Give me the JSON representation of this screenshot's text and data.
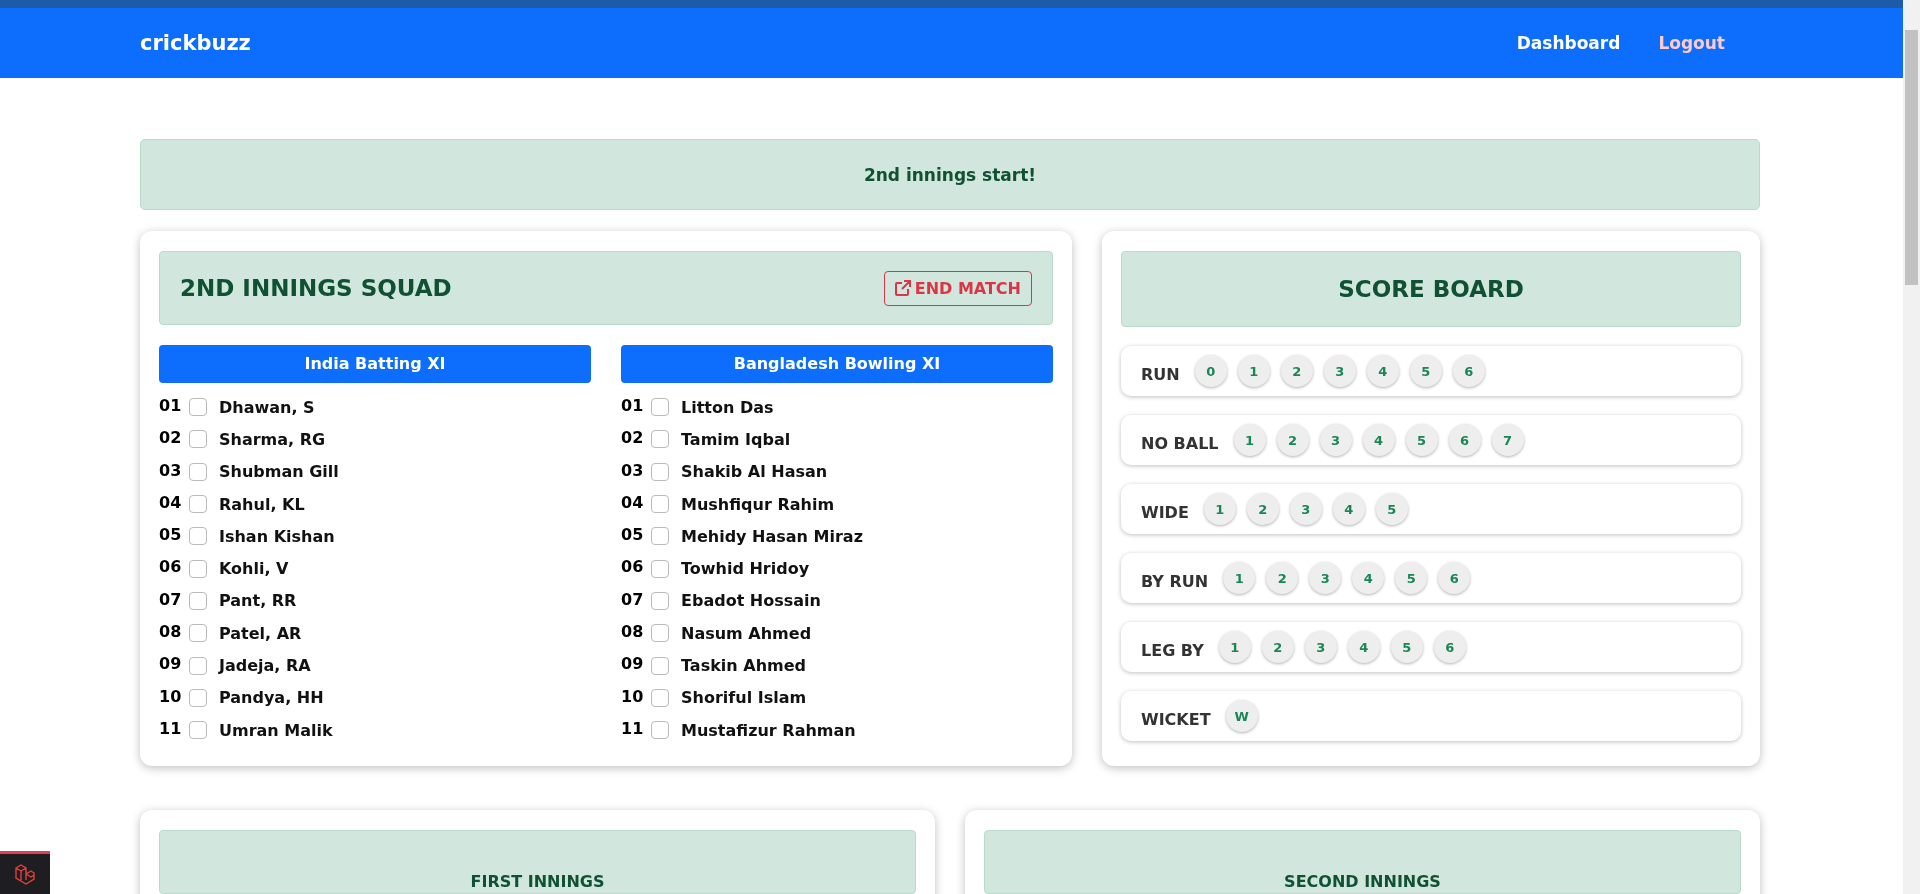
{
  "navbar": {
    "brand": "crickbuzz",
    "links": [
      {
        "label": "Dashboard",
        "kind": "normal"
      },
      {
        "label": "Logout",
        "kind": "danger"
      }
    ]
  },
  "alert": "2nd innings start!",
  "squad": {
    "title": "2ND INNINGS SQUAD",
    "end_button": "END MATCH",
    "teams": [
      {
        "title": "India Batting XI",
        "players": [
          {
            "no": "01",
            "name": "Dhawan, S",
            "checked": false
          },
          {
            "no": "02",
            "name": "Sharma, RG",
            "checked": false
          },
          {
            "no": "03",
            "name": "Shubman Gill",
            "checked": false
          },
          {
            "no": "04",
            "name": "Rahul, KL",
            "checked": false
          },
          {
            "no": "05",
            "name": "Ishan Kishan",
            "checked": false
          },
          {
            "no": "06",
            "name": "Kohli, V",
            "checked": false
          },
          {
            "no": "07",
            "name": "Pant, RR",
            "checked": false
          },
          {
            "no": "08",
            "name": "Patel, AR",
            "checked": false
          },
          {
            "no": "09",
            "name": "Jadeja, RA",
            "checked": false
          },
          {
            "no": "10",
            "name": "Pandya, HH",
            "checked": false
          },
          {
            "no": "11",
            "name": "Umran Malik",
            "checked": false
          }
        ]
      },
      {
        "title": "Bangladesh Bowling XI",
        "players": [
          {
            "no": "01",
            "name": "Litton Das",
            "checked": false
          },
          {
            "no": "02",
            "name": "Tamim Iqbal",
            "checked": false
          },
          {
            "no": "03",
            "name": "Shakib Al Hasan",
            "checked": false
          },
          {
            "no": "04",
            "name": "Mushfiqur Rahim",
            "checked": false
          },
          {
            "no": "05",
            "name": "Mehidy Hasan Miraz",
            "checked": false
          },
          {
            "no": "06",
            "name": "Towhid Hridoy",
            "checked": false
          },
          {
            "no": "07",
            "name": "Ebadot Hossain",
            "checked": false
          },
          {
            "no": "08",
            "name": "Nasum Ahmed",
            "checked": false
          },
          {
            "no": "09",
            "name": "Taskin Ahmed",
            "checked": false
          },
          {
            "no": "10",
            "name": "Shoriful Islam",
            "checked": false
          },
          {
            "no": "11",
            "name": "Mustafizur Rahman",
            "checked": false
          }
        ]
      }
    ]
  },
  "scoreboard": {
    "title": "SCORE BOARD",
    "rows": [
      {
        "label": "RUN",
        "buttons": [
          "0",
          "1",
          "2",
          "3",
          "4",
          "5",
          "6"
        ]
      },
      {
        "label": "NO BALL",
        "buttons": [
          "1",
          "2",
          "3",
          "4",
          "5",
          "6",
          "7"
        ]
      },
      {
        "label": "WIDE",
        "buttons": [
          "1",
          "2",
          "3",
          "4",
          "5"
        ]
      },
      {
        "label": "BY RUN",
        "buttons": [
          "1",
          "2",
          "3",
          "4",
          "5",
          "6"
        ]
      },
      {
        "label": "LEG BY",
        "buttons": [
          "1",
          "2",
          "3",
          "4",
          "5",
          "6"
        ]
      },
      {
        "label": "WICKET",
        "buttons": [
          "W"
        ]
      }
    ]
  },
  "innings_panels": [
    {
      "title": "FIRST INNINGS"
    },
    {
      "title": "SECOND INNINGS"
    }
  ]
}
